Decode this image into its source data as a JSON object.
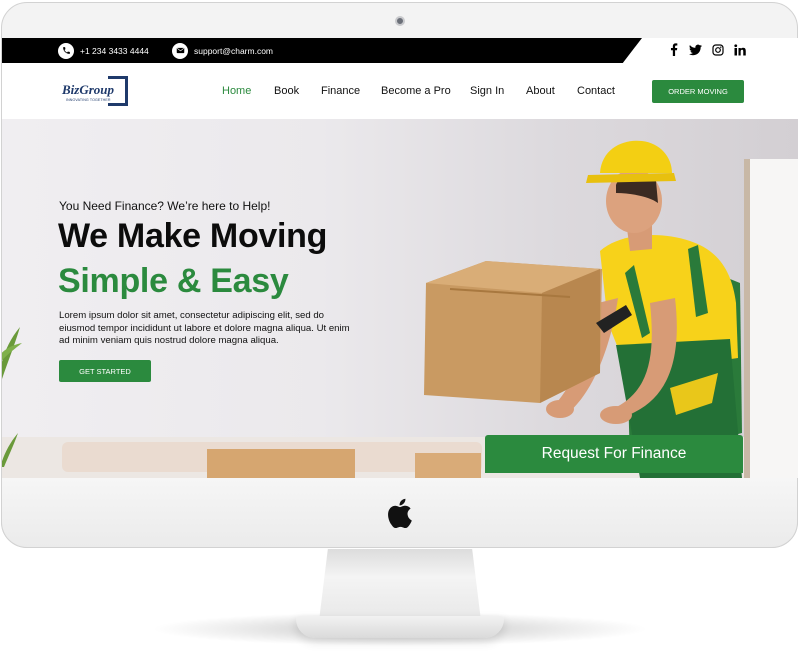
{
  "topbar": {
    "phone": "+1 234 3433 4444",
    "email": "support@charm.com",
    "social_icons": [
      "facebook-icon",
      "twitter-icon",
      "instagram-icon",
      "linkedin-icon"
    ]
  },
  "logo": {
    "name": "BizGroup",
    "tagline": "INNOVATING TOGETHER"
  },
  "nav": {
    "items": [
      {
        "label": "Home",
        "active": true
      },
      {
        "label": "Book"
      },
      {
        "label": "Finance"
      },
      {
        "label": "Become a Pro"
      },
      {
        "label": "Sign In"
      },
      {
        "label": "About"
      },
      {
        "label": "Contact"
      }
    ],
    "cta_label": "ORDER MOVING"
  },
  "hero": {
    "kicker": "You Need Finance? We’re here to Help!",
    "headline_1": "We Make Moving",
    "headline_2": "Simple & Easy",
    "body": "Lorem ipsum dolor sit amet, consectetur adipiscing elit, sed do eiusmod tempor incididunt ut labore et dolore magna aliqua. Ut enim ad minim veniam quis nostrud dolore magna aliqua.",
    "cta_label": "GET STARTED",
    "finance_label": "Request For Finance"
  },
  "colors": {
    "accent": "#2b8a3e",
    "topbar": "#000000",
    "brand_navy": "#1f3a6b"
  }
}
